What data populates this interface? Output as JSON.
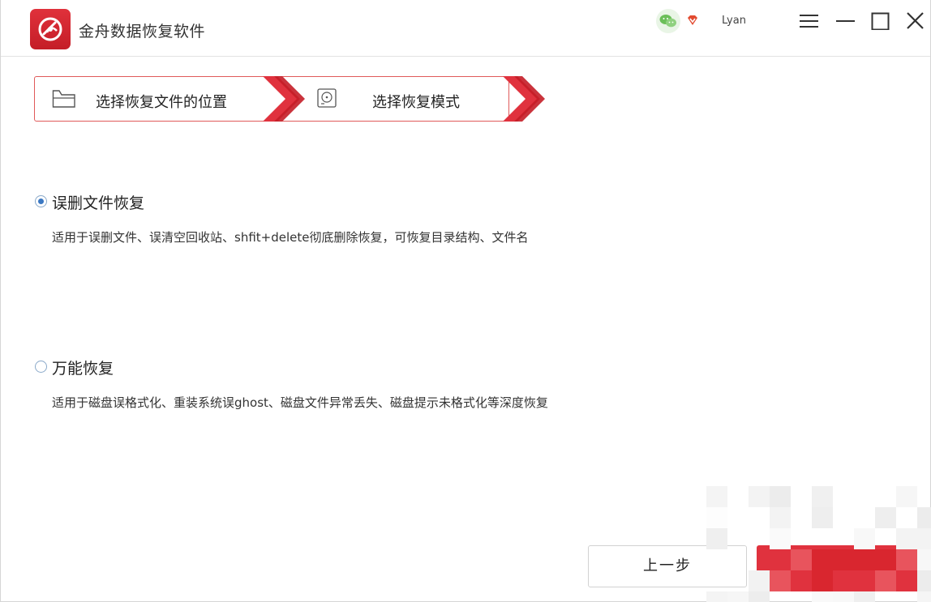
{
  "app": {
    "title": "金舟数据恢复软件",
    "username": "Lyan",
    "accent_color": "#e0323e"
  },
  "header_icons": {
    "logo": "app-logo-icon",
    "wechat": "wechat-icon",
    "vip": "vip-diamond-icon",
    "menu": "hamburger-menu-icon",
    "minimize": "minimize-icon",
    "maximize": "maximize-icon",
    "close": "close-icon"
  },
  "steps": [
    {
      "label": "选择恢复文件的位置",
      "icon": "folder-icon"
    },
    {
      "label": "选择恢复模式",
      "icon": "disk-icon"
    }
  ],
  "options": [
    {
      "title": "误删文件恢复",
      "description": "适用于误删文件、误清空回收站、shfit+delete彻底删除恢复，可恢复目录结构、文件名",
      "selected": true
    },
    {
      "title": "万能恢复",
      "description": "适用于磁盘误格式化、重装系统误ghost、磁盘文件异常丢失、磁盘提示未格式化等深度恢复",
      "selected": false
    }
  ],
  "footer": {
    "prev_label": "上一步"
  }
}
